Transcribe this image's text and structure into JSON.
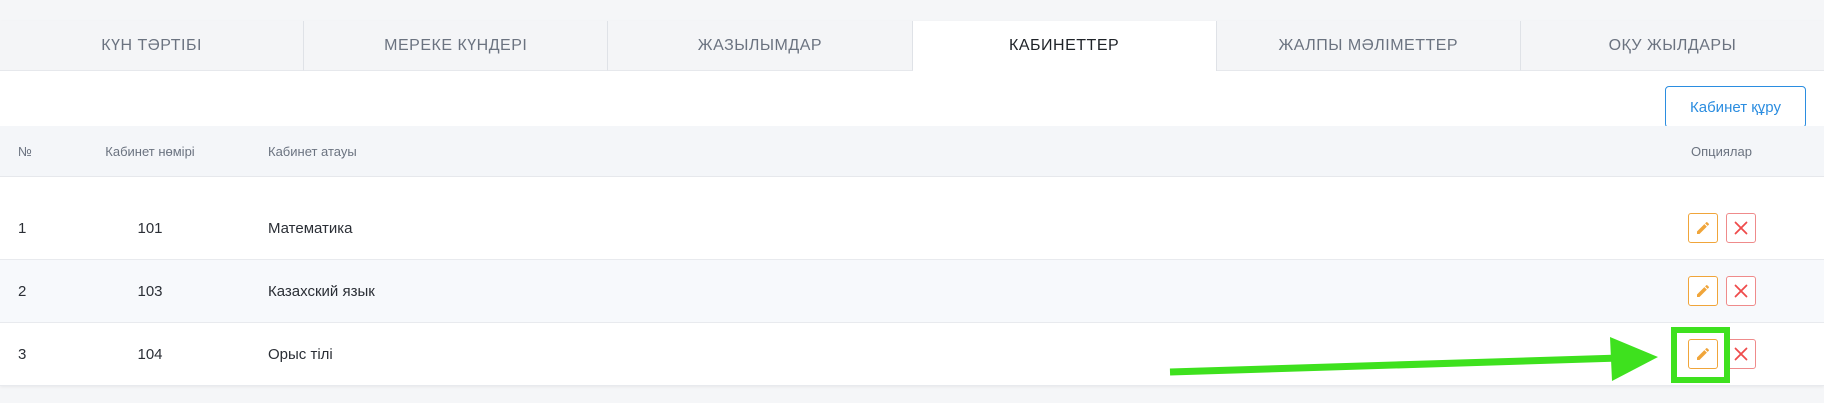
{
  "tabs": [
    {
      "label": "КҮН ТӘРТІБІ"
    },
    {
      "label": "МЕРЕКЕ КҮНДЕРІ"
    },
    {
      "label": "ЖАЗЫЛЫМДАР"
    },
    {
      "label": "КАБИНЕТТЕР"
    },
    {
      "label": "ЖАЛПЫ МӘЛІМЕТТЕР"
    },
    {
      "label": "ОҚУ ЖЫЛДАРЫ"
    }
  ],
  "active_tab": "КАБИНЕТТЕР",
  "create_button": "Кабинет құру",
  "table": {
    "headers": {
      "num": "№",
      "room": "Кабинет нөмірі",
      "name": "Кабинет атауы",
      "options": "Опциялар"
    },
    "rows": [
      {
        "num": "1",
        "room": "101",
        "name": "Математика"
      },
      {
        "num": "2",
        "room": "103",
        "name": "Казахский язык"
      },
      {
        "num": "3",
        "room": "104",
        "name": "Орыс тілі"
      }
    ]
  },
  "icons": {
    "edit": "pencil-icon",
    "delete": "close-icon"
  },
  "colors": {
    "accent": "#2b8de0",
    "edit": "#f0a53a",
    "delete": "#ef4b4b",
    "annotation": "#3ee11e"
  }
}
